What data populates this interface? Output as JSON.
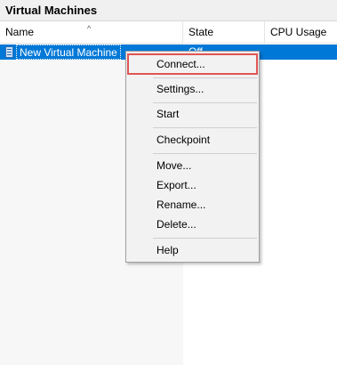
{
  "panel": {
    "title": "Virtual Machines"
  },
  "columns": {
    "name": "Name",
    "state": "State",
    "cpu": "CPU Usage",
    "sort_indicator": "^"
  },
  "rows": [
    {
      "name": "New Virtual Machine",
      "state": "Off",
      "icon": "vm-icon"
    }
  ],
  "context_menu": {
    "items": [
      {
        "label": "Connect..."
      },
      {
        "label": "Settings..."
      },
      {
        "label": "Start"
      },
      {
        "label": "Checkpoint"
      },
      {
        "label": "Move..."
      },
      {
        "label": "Export..."
      },
      {
        "label": "Rename..."
      },
      {
        "label": "Delete..."
      },
      {
        "label": "Help"
      }
    ]
  },
  "colors": {
    "selection": "#0078d7",
    "highlight_outline": "#e05555"
  }
}
